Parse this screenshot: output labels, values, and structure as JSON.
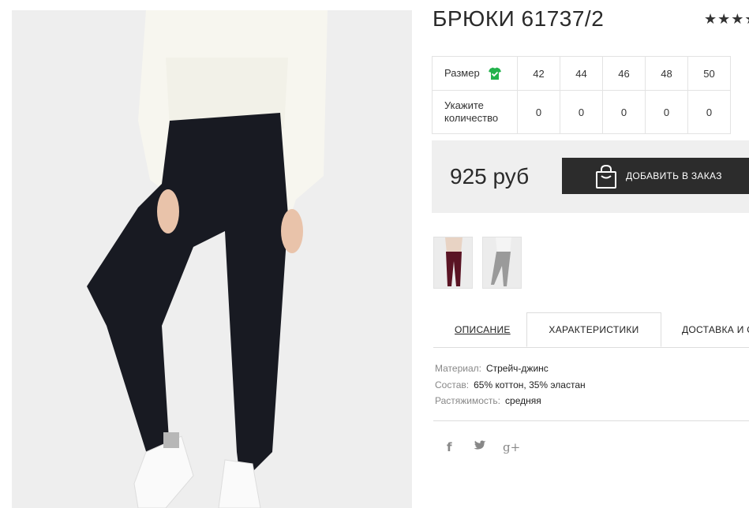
{
  "product": {
    "title": "БРЮКИ 61737/2",
    "rating_stars": "★★★★"
  },
  "sizes": {
    "header_label": "Размер",
    "qty_label": "Укажите количество",
    "values": [
      "42",
      "44",
      "46",
      "48",
      "50"
    ],
    "quantities": [
      "0",
      "0",
      "0",
      "0",
      "0"
    ]
  },
  "buy": {
    "price": "925 руб",
    "button_label": "ДОБАВИТЬ В ЗАКАЗ"
  },
  "tabs": [
    {
      "label": "ОПИСАНИЕ"
    },
    {
      "label": "ХАРАКТЕРИСТИКИ"
    },
    {
      "label": "ДОСТАВКА И О"
    }
  ],
  "specs": [
    {
      "key": "Материал:",
      "value": "Стрейч-джинс"
    },
    {
      "key": "Состав:",
      "value": "65% коттон, 35% эластан"
    },
    {
      "key": "Растяжимость:",
      "value": "средняя"
    }
  ],
  "share": {
    "facebook": "f",
    "twitter": "🐦",
    "googleplus": "g+"
  },
  "colors": {
    "button_bg": "#2c2c2c",
    "buybox_bg": "#efefef",
    "check_icon": "#22b24c",
    "thumb_burgundy": "#5a1424"
  }
}
